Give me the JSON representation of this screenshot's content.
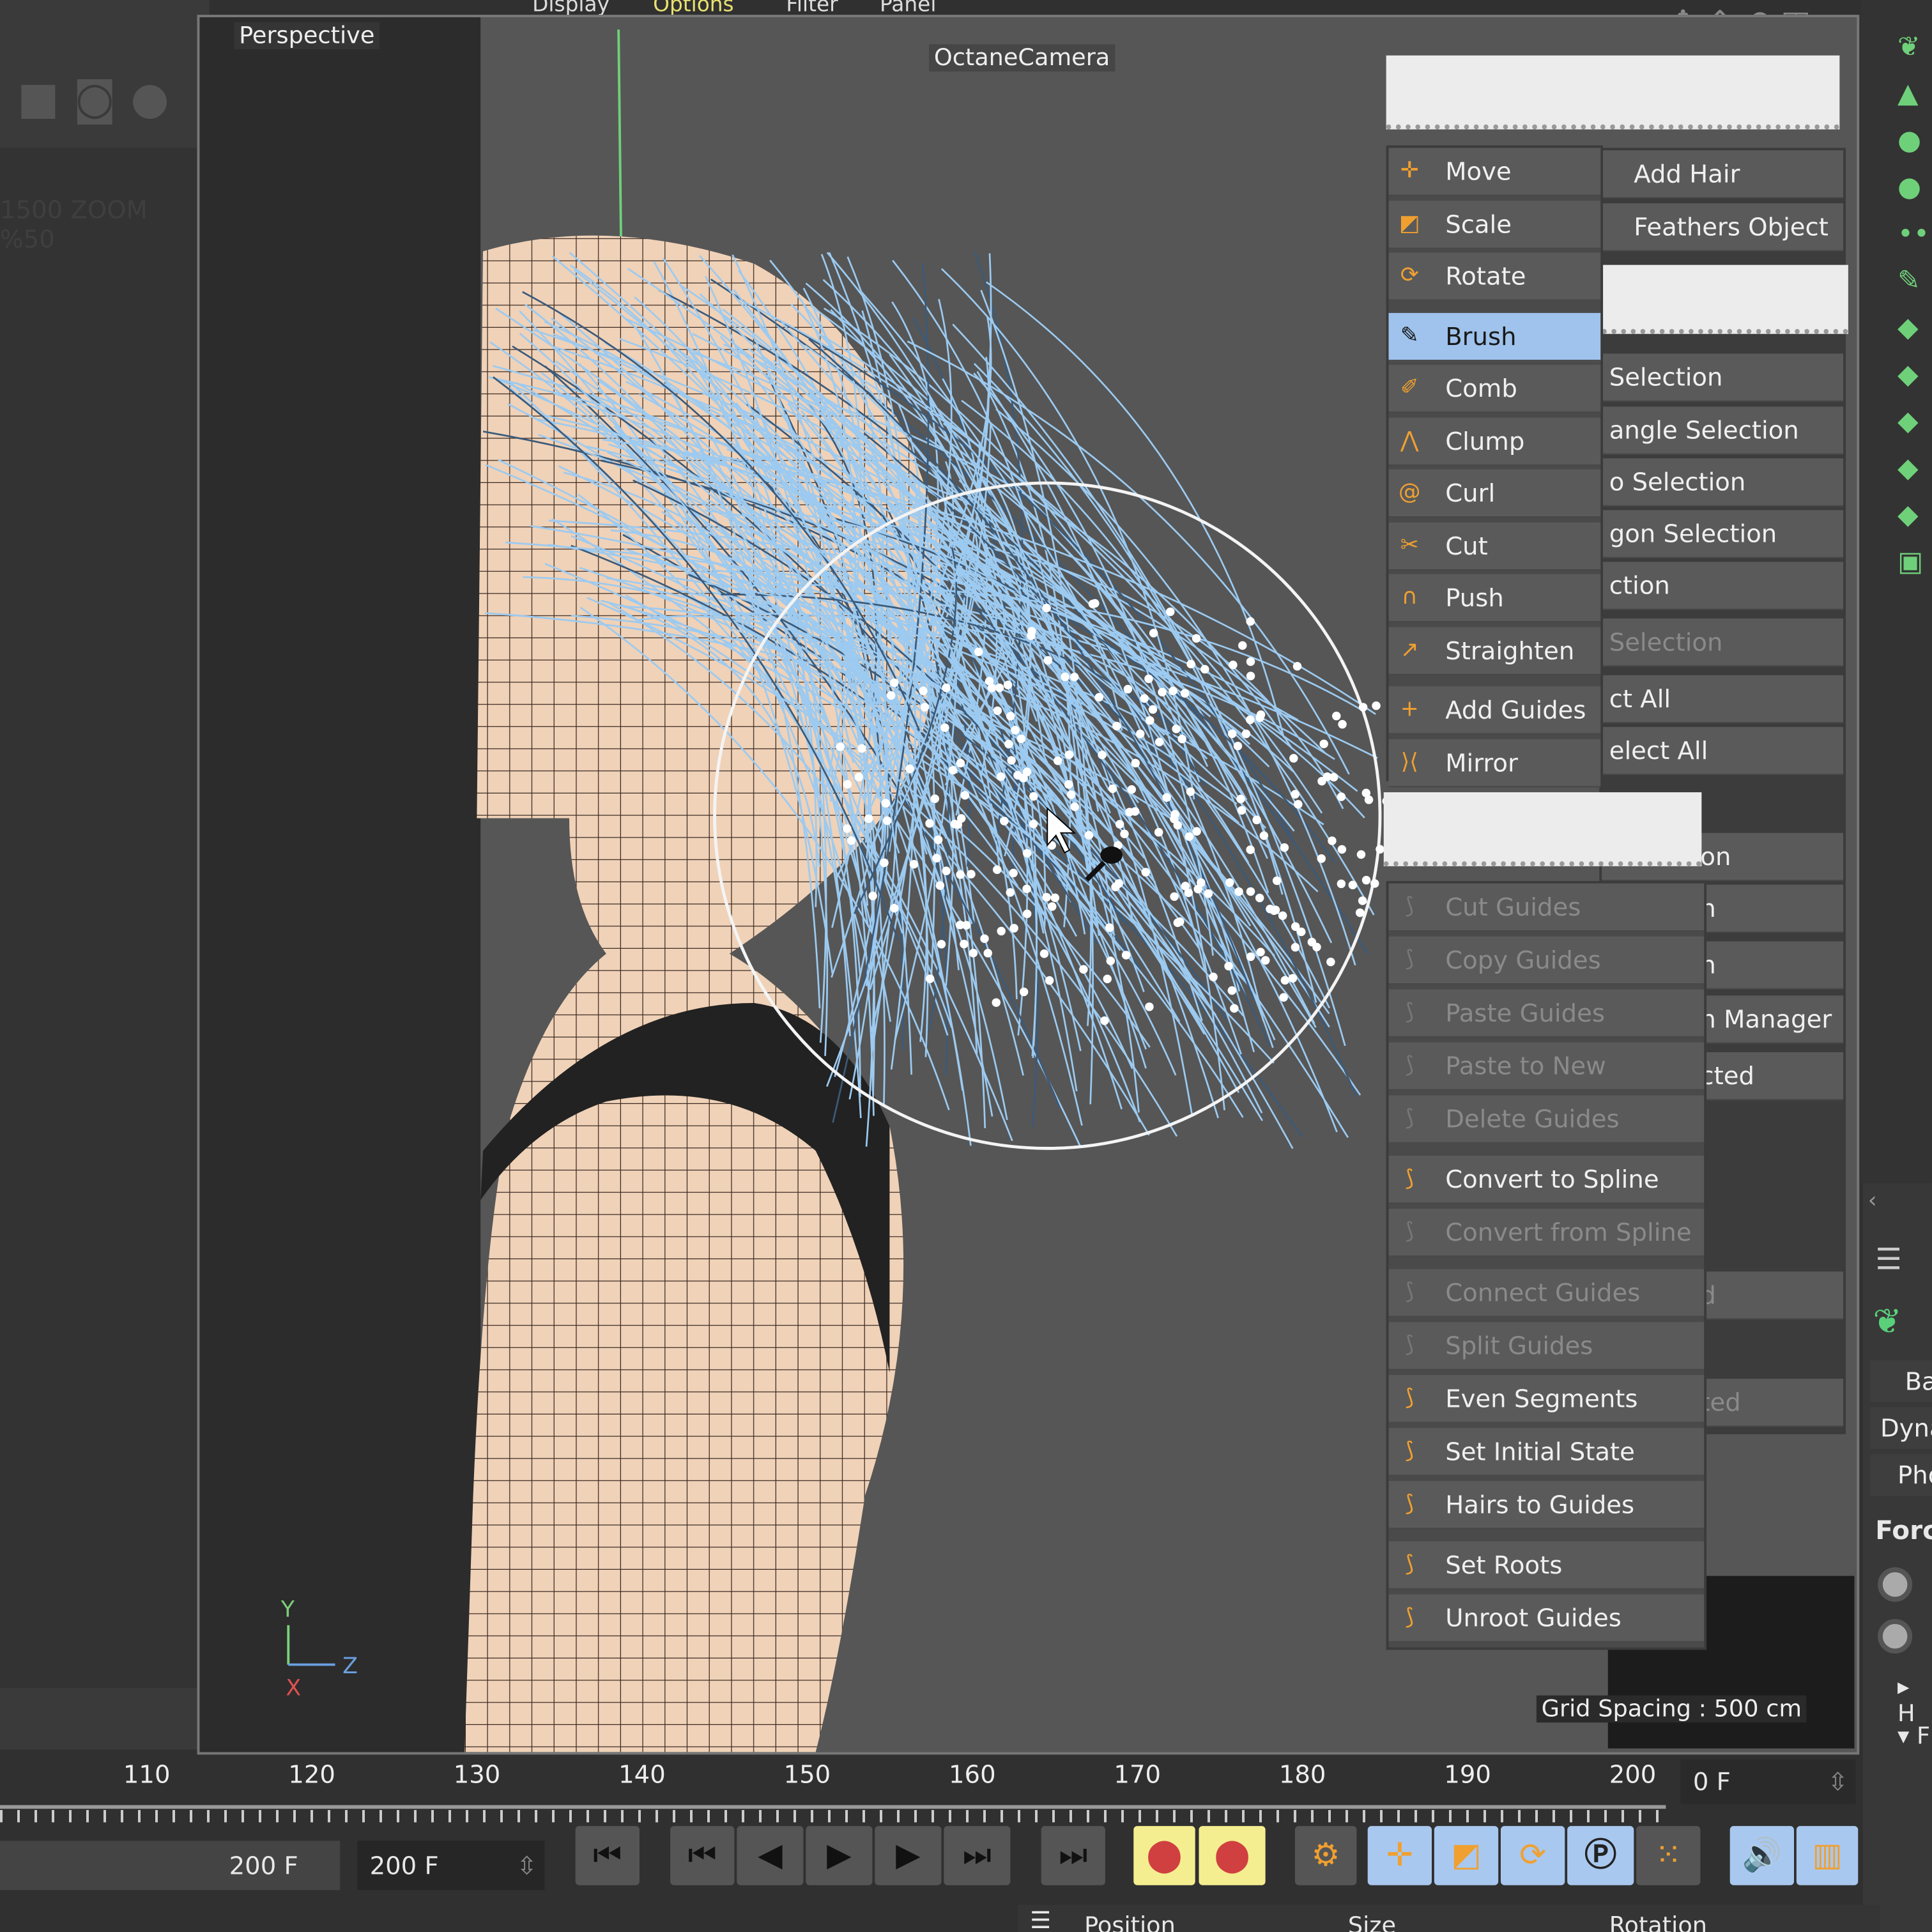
{
  "menubar": [
    "Display",
    "Options",
    "Filter",
    "Panel"
  ],
  "viewport": {
    "view_name": "Perspective",
    "camera": "OctaneCamera",
    "grid_spacing": "Grid Spacing : 500 cm",
    "axes": {
      "y": "Y",
      "z": "Z",
      "x": "X"
    }
  },
  "left_panel": {
    "faded_text": "1500 ZOOM %50"
  },
  "tools_menu": {
    "group1": [
      {
        "label": "Move",
        "icon": "move-icon"
      },
      {
        "label": "Scale",
        "icon": "scale-icon"
      },
      {
        "label": "Rotate",
        "icon": "rotate-icon"
      }
    ],
    "group2": [
      {
        "label": "Brush",
        "icon": "brush-icon",
        "selected": true
      },
      {
        "label": "Comb",
        "icon": "comb-icon"
      },
      {
        "label": "Clump",
        "icon": "clump-icon"
      },
      {
        "label": "Curl",
        "icon": "curl-icon"
      },
      {
        "label": "Cut",
        "icon": "cut-icon"
      },
      {
        "label": "Push",
        "icon": "push-icon"
      },
      {
        "label": "Straighten",
        "icon": "straighten-icon"
      }
    ],
    "group3": [
      {
        "label": "Add Guides",
        "icon": "add-guides-icon"
      },
      {
        "label": "Mirror",
        "icon": "mirror-icon"
      }
    ]
  },
  "guides_menu": [
    {
      "label": "Cut Guides",
      "disabled": true
    },
    {
      "label": "Copy Guides",
      "disabled": true
    },
    {
      "label": "Paste Guides",
      "disabled": true
    },
    {
      "label": "Paste to New",
      "disabled": true
    },
    {
      "label": "Delete Guides",
      "disabled": true
    },
    {
      "label": "Convert to Spline",
      "disabled": false
    },
    {
      "label": "Convert from Spline",
      "disabled": true
    },
    {
      "label": "Connect Guides",
      "disabled": true
    },
    {
      "label": "Split Guides",
      "disabled": true
    },
    {
      "label": "Even Segments",
      "disabled": false
    },
    {
      "label": "Set Initial State",
      "disabled": false
    },
    {
      "label": "Hairs to Guides",
      "disabled": false
    },
    {
      "label": "Set Roots",
      "disabled": false
    },
    {
      "label": "Unroot Guides",
      "disabled": false
    }
  ],
  "right_menu": {
    "top": [
      "Add Hair",
      "Feathers Object"
    ],
    "selection": [
      "Selection",
      "angle Selection",
      "o Selection",
      "gon Selection",
      "ction"
    ],
    "selection_disabled": "Selection",
    "select": [
      "ct All",
      "elect All"
    ],
    "lower": [
      "on",
      "n",
      "n",
      "n Manager",
      "cted"
    ],
    "lower2": [
      "d",
      "ted"
    ]
  },
  "timeline": {
    "ticks": [
      "110",
      "120",
      "130",
      "140",
      "150",
      "160",
      "170",
      "180",
      "190",
      "200"
    ],
    "current_frame": "0 F",
    "end_frame": "200 F",
    "max_frame": "200 F"
  },
  "coords_header": [
    "Position",
    "Size",
    "Rotation"
  ],
  "attributes": {
    "tabs": [
      "Ba",
      "Dyna",
      "Pho"
    ],
    "section": "Forc",
    "groups": [
      "H",
      "F"
    ]
  },
  "colors": {
    "menu_selected": "#9fc3ec",
    "hair_guides": "#9ccaf0",
    "skin": "#f0d2b8",
    "record_active": "#f4ee90",
    "accent": "#f0a030"
  }
}
